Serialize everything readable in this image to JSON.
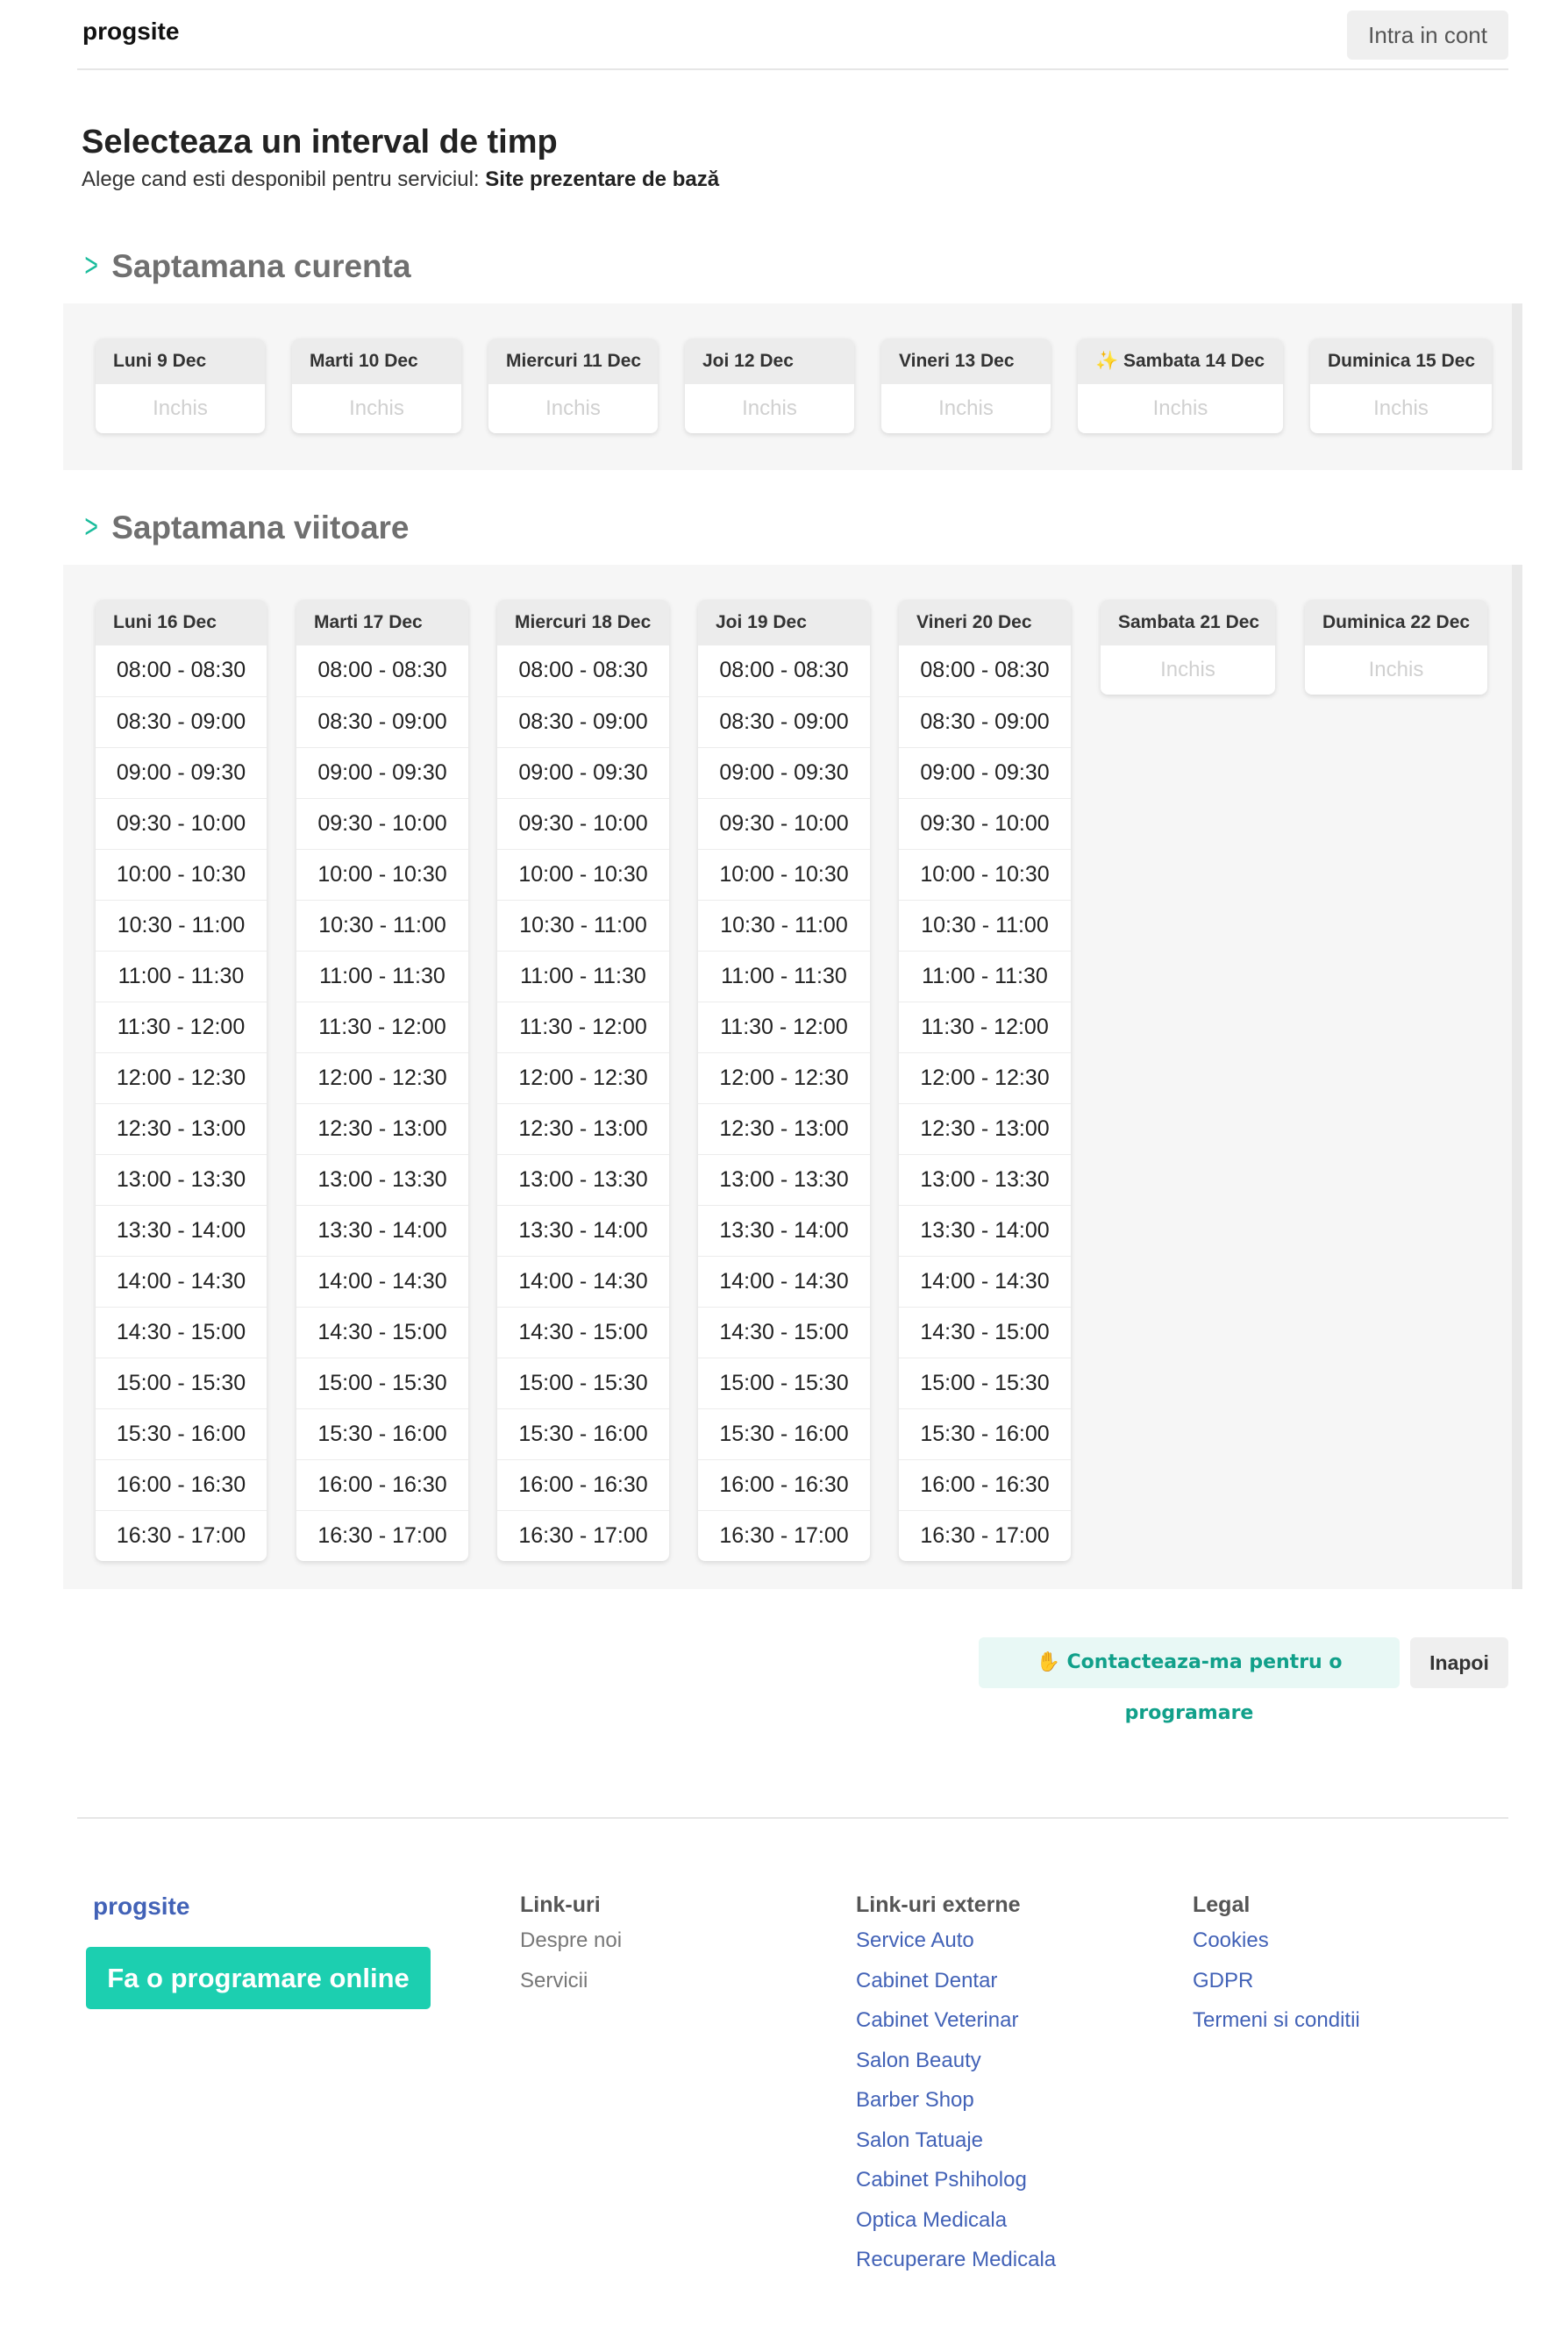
{
  "header": {
    "brand": "progsite",
    "login_label": "Intra in cont"
  },
  "page": {
    "title": "Selecteaza un interval de timp",
    "subtitle_prefix": "Alege cand esti desponibil pentru serviciul:",
    "service_name": "Site prezentare de bază"
  },
  "current_week": {
    "title": "Saptamana curenta",
    "closed_label": "Inchis",
    "days": [
      {
        "label": "Luni 9 Dec"
      },
      {
        "label": "Marti 10 Dec"
      },
      {
        "label": "Miercuri 11 Dec"
      },
      {
        "label": "Joi 12 Dec"
      },
      {
        "label": "Vineri 13 Dec"
      },
      {
        "label": "✨ Sambata 14 Dec"
      },
      {
        "label": "Duminica 15 Dec"
      }
    ]
  },
  "next_week": {
    "title": "Saptamana viitoare",
    "closed_label": "Inchis",
    "days": [
      {
        "label": "Luni 16 Dec"
      },
      {
        "label": "Marti 17 Dec"
      },
      {
        "label": "Miercuri 18 Dec"
      },
      {
        "label": "Joi 19 Dec"
      },
      {
        "label": "Vineri 20 Dec"
      },
      {
        "label": "Sambata 21 Dec"
      },
      {
        "label": "Duminica 22 Dec"
      }
    ],
    "slots": [
      "08:00 - 08:30",
      "08:30 - 09:00",
      "09:00 - 09:30",
      "09:30 - 10:00",
      "10:00 - 10:30",
      "10:30 - 11:00",
      "11:00 - 11:30",
      "11:30 - 12:00",
      "12:00 - 12:30",
      "12:30 - 13:00",
      "13:00 - 13:30",
      "13:30 - 14:00",
      "14:00 - 14:30",
      "14:30 - 15:00",
      "15:00 - 15:30",
      "15:30 - 16:00",
      "16:00 - 16:30",
      "16:30 - 17:00"
    ]
  },
  "actions": {
    "contact_label": "✋ Contacteaza-ma pentru o programare",
    "back_label": "Inapoi"
  },
  "footer": {
    "brand": "progsite",
    "cta_label": "Fa o programare online",
    "links": {
      "title": "Link-uri",
      "items": [
        "Despre noi",
        "Servicii"
      ]
    },
    "external": {
      "title": "Link-uri externe",
      "items": [
        "Service Auto",
        "Cabinet Dentar",
        "Cabinet Veterinar",
        "Salon Beauty",
        "Barber Shop",
        "Salon Tatuaje",
        "Cabinet Pshiholog",
        "Optica Medicala",
        "Recuperare Medicala"
      ]
    },
    "legal": {
      "title": "Legal",
      "items": [
        "Cookies",
        "GDPR",
        "Termeni si conditii"
      ]
    }
  },
  "colors": {
    "accent": "#1abc9c",
    "cta": "#1ccfb0",
    "link": "#4262b7"
  }
}
